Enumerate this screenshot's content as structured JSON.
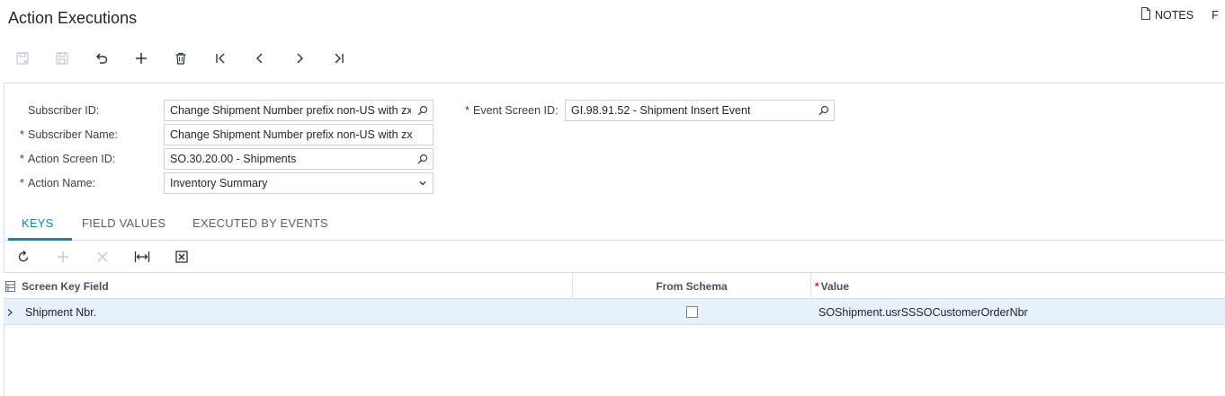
{
  "page": {
    "title": "Action Executions",
    "notes_label": "NOTES",
    "files_label": "F"
  },
  "toolbar": {
    "buttons": [
      "cancel-edit",
      "save",
      "undo",
      "add",
      "delete",
      "first",
      "previous",
      "next",
      "last"
    ]
  },
  "form": {
    "subscriber_id": {
      "label": "Subscriber ID:",
      "value": "Change Shipment Number prefix non-US with zx",
      "required": false
    },
    "subscriber_name": {
      "label": "Subscriber Name:",
      "value": "Change Shipment Number prefix non-US with zx",
      "required": true
    },
    "action_screen_id": {
      "label": "Action Screen ID:",
      "value": "SO.30.20.00 - Shipments",
      "required": true
    },
    "action_name": {
      "label": "Action Name:",
      "value": "Inventory Summary",
      "required": true
    },
    "event_screen_id": {
      "label": "Event Screen ID:",
      "value": "GI.98.91.52 - Shipment Insert Event",
      "required": true
    },
    "required_marker": "*"
  },
  "tabs": [
    {
      "label": "KEYS",
      "active": true
    },
    {
      "label": "FIELD VALUES",
      "active": false
    },
    {
      "label": "EXECUTED BY EVENTS",
      "active": false
    }
  ],
  "grid": {
    "columns": {
      "screen_key_field": "Screen Key Field",
      "from_schema": "From Schema",
      "value": "Value"
    },
    "rows": [
      {
        "screen_key_field": "Shipment Nbr.",
        "from_schema": false,
        "value": "SOShipment.usrSSSOCustomerOrderNbr"
      }
    ]
  },
  "colors": {
    "accent": "#1780b7",
    "selected_row": "#e6f1fa",
    "required": "#e02020"
  }
}
